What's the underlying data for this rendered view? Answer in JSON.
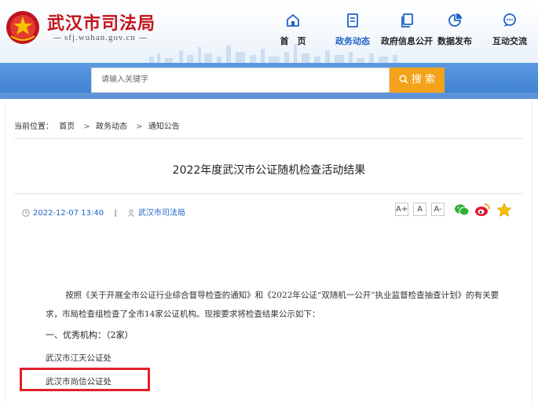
{
  "site": {
    "name": "武汉市司法局",
    "domain": "sfj.wuhan.gov.cn"
  },
  "nav": {
    "items": [
      {
        "label": "首　页",
        "icon": "home-icon",
        "active": false
      },
      {
        "label": "政务动态",
        "icon": "document-icon",
        "active": true
      },
      {
        "label": "政府信息公开",
        "icon": "copy-icon",
        "active": false
      },
      {
        "label": "数据发布",
        "icon": "chart-pie-icon",
        "active": false
      },
      {
        "label": "互动交流",
        "icon": "chat-icon",
        "active": false
      }
    ],
    "active_color": "#1f63c6"
  },
  "search": {
    "placeholder": "请输入关键字",
    "button_label": "搜 索",
    "button_color": "#f5a21b"
  },
  "breadcrumb": {
    "prefix": "当前位置：",
    "items": [
      "首页",
      "政务动态",
      "通知公告"
    ],
    "separator": ">"
  },
  "article": {
    "title": "2022年度武汉市公证随机检查活动结果",
    "date": "2022-12-07 13:40",
    "meta_separator": "|",
    "source": "武汉市司法局",
    "font_sizes": [
      "A+",
      "A",
      "A-"
    ],
    "share_icons": [
      "wechat-icon",
      "weibo-icon",
      "favorite-star-icon"
    ],
    "paragraph1": "按照《关于开展全市公证行业综合督导检查的通知》和《2022年公证“双随机一公开”执业监督检查抽查计划》的有关要求，市局检查组检查了全市14家公证机构。现按要求将检查结果公示如下：",
    "heading1": "一、优秀机构：（2家）",
    "org1": "武汉市江天公证处",
    "org2": "武汉市尚信公证处"
  },
  "colors": {
    "brand_red": "#c0141b",
    "banner_blue": "#4a8bd8",
    "highlight_red": "#e0202a"
  }
}
